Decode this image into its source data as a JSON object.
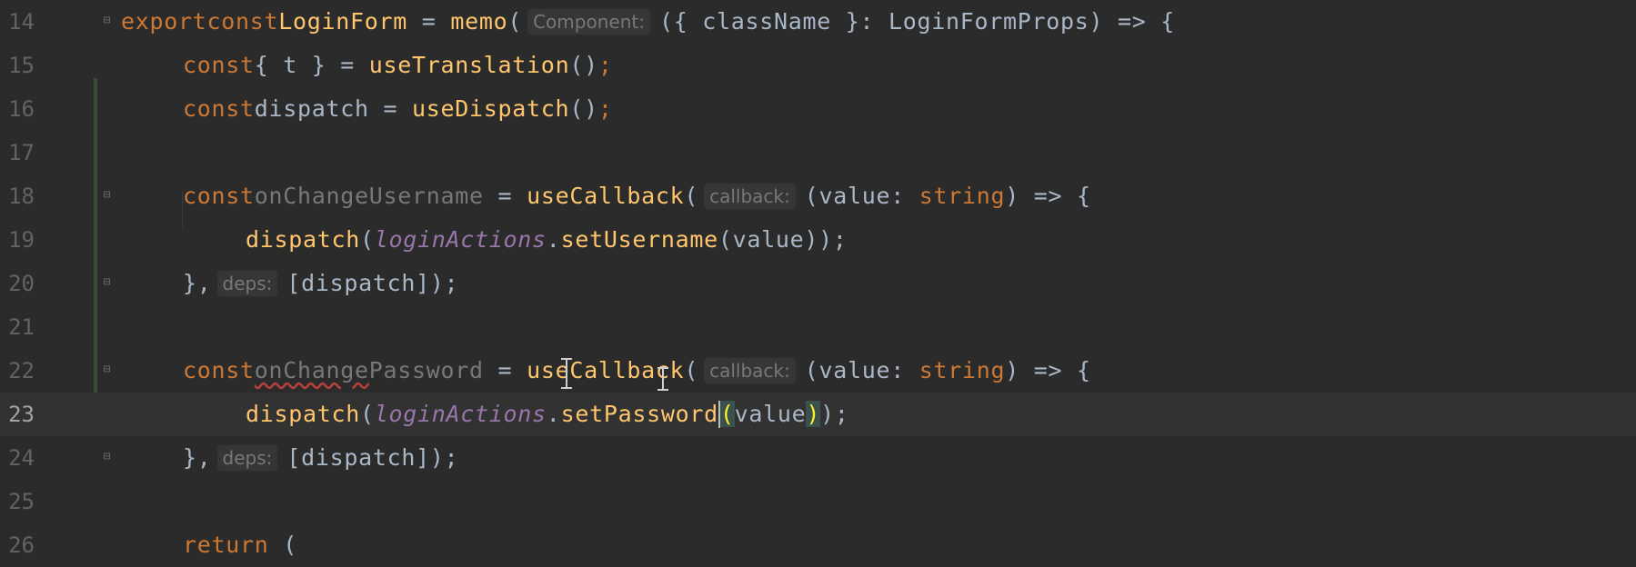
{
  "editor": {
    "lines": [
      {
        "num": "14"
      },
      {
        "num": "15"
      },
      {
        "num": "16"
      },
      {
        "num": "17"
      },
      {
        "num": "18"
      },
      {
        "num": "19"
      },
      {
        "num": "20"
      },
      {
        "num": "21"
      },
      {
        "num": "22"
      },
      {
        "num": "23"
      },
      {
        "num": "24"
      },
      {
        "num": "25"
      },
      {
        "num": "26"
      }
    ],
    "tokens": {
      "export": "export",
      "const": "const",
      "LoginForm": "LoginForm",
      "eq": " = ",
      "memo": "memo",
      "paren_open": "(",
      "hint_component": "Component:",
      "params_line14": "({ className }: LoginFormProps) => {",
      "t_destructure": "{ t }",
      "useTranslation": "useTranslation",
      "call_empty": "()",
      "semicolon": ";",
      "dispatch": "dispatch",
      "useDispatch": "useDispatch",
      "onChangeUsername": "onChangeUsername",
      "useCallback": "useCallback",
      "hint_callback": "callback:",
      "value_param": "(value: ",
      "string": "string",
      "arrow_open": ") => {",
      "loginActions": "loginActions",
      "dot": ".",
      "setUsername": "setUsername",
      "value_arg": "(value));",
      "close_brace": "},",
      "hint_deps": "deps:",
      "deps_array": "[dispatch]);",
      "onChange": "onChange",
      "Password": "Password",
      "setPassword": "setPassword",
      "value": "value",
      "close_paren_semi": ");",
      "return": "return",
      "return_open": " ("
    }
  },
  "colors": {
    "background": "#2b2b2b",
    "keyword": "#cc7832",
    "function": "#ffc66d",
    "identifier": "#a9b7c6",
    "italic_member": "#9876aa",
    "line_number": "#606366",
    "typo_underline": "#bc3f3c"
  },
  "icons": [
    "fold-marker-icon",
    "text-cursor-icon"
  ]
}
